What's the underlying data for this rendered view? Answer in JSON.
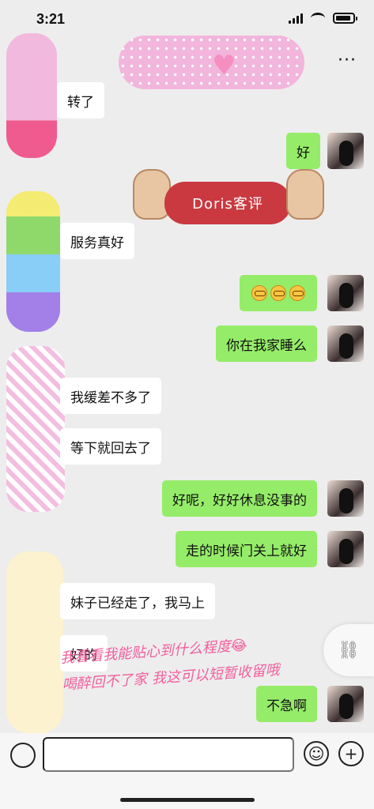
{
  "status": {
    "time": "3:21"
  },
  "header": {
    "more": "···"
  },
  "messages": [
    {
      "side": "in",
      "text": "转了"
    },
    {
      "side": "out",
      "text": "好"
    },
    {
      "side": "in",
      "text": "服务真好"
    },
    {
      "side": "out",
      "text": ""
    },
    {
      "side": "out",
      "text": "你在我家睡么"
    },
    {
      "side": "in",
      "text": "我缓差不多了"
    },
    {
      "side": "in",
      "text": "等下就回去了"
    },
    {
      "side": "out",
      "text": "好呢，好好休息没事的"
    },
    {
      "side": "out",
      "text": "走的时候门关上就好"
    },
    {
      "side": "in",
      "text": "妹子已经走了，我马上"
    },
    {
      "side": "in",
      "text": "好的"
    },
    {
      "side": "out",
      "text": "不急啊"
    }
  ],
  "sticker": {
    "title": "Doris客评"
  },
  "caption": {
    "line1": "我看看我能贴心到什么程度😂",
    "line2": "喝醉回不了家 我这可以短暂收留哦"
  },
  "input": {
    "placeholder": ""
  },
  "icons": {
    "more": "more-icon",
    "voice": "voice-icon",
    "emoji": "emoji-icon",
    "plus": "plus-icon",
    "link": "link-icon"
  }
}
